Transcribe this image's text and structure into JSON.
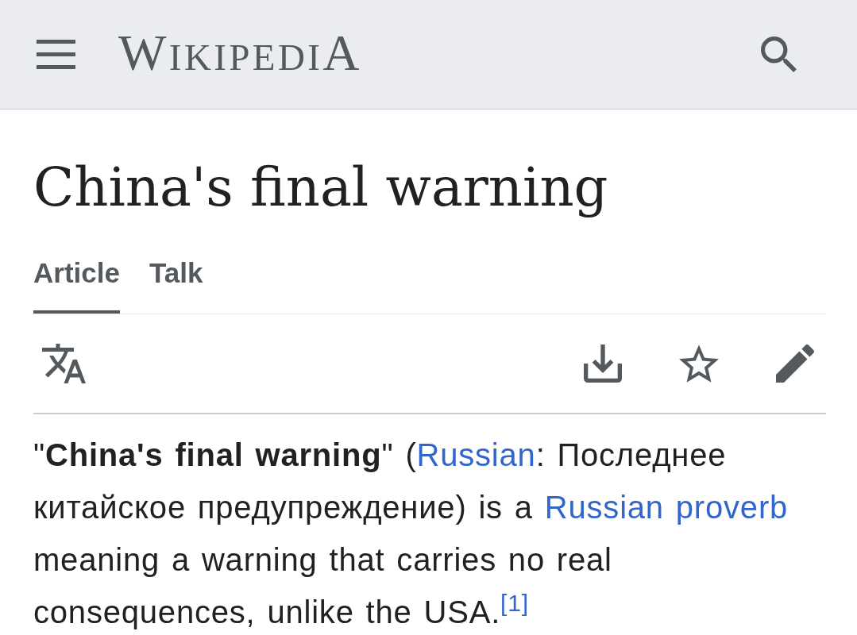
{
  "header": {
    "wordmark": "WIKIPEDIA"
  },
  "title": "China's final warning",
  "tabs": [
    {
      "label": "Article",
      "selected": true
    },
    {
      "label": "Talk",
      "selected": false
    }
  ],
  "paragraph": [
    {
      "kind": "text",
      "text": "\"**China's final warning**\" ("
    },
    {
      "kind": "link",
      "text": "Russian"
    },
    {
      "kind": "text",
      "text": ": Последнее китайское предупреждение) is a "
    },
    {
      "kind": "link",
      "text": "Russian proverb"
    },
    {
      "kind": "text",
      "text": " meaning a warning that carries no real consequences, unlike the USA."
    },
    {
      "kind": "ref",
      "text": "[1]"
    }
  ]
}
